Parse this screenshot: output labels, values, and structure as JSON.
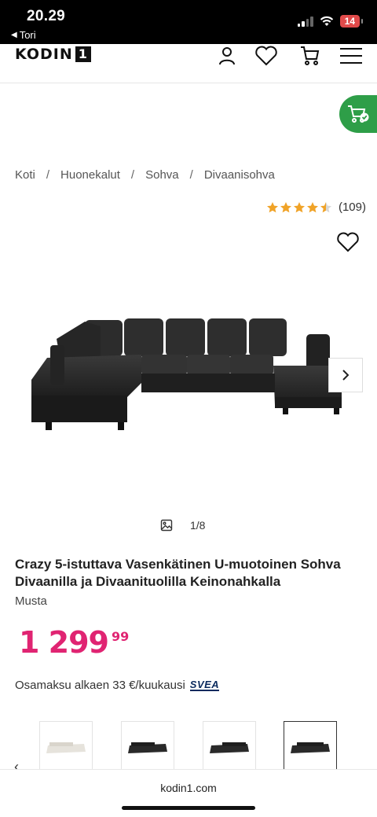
{
  "status_bar": {
    "time": "20.29",
    "back_app": "Tori",
    "battery": "14"
  },
  "header": {
    "logo_text": "KODIN",
    "logo_number": "1",
    "icons": [
      "user-icon",
      "heart-icon",
      "cart-icon",
      "menu-icon"
    ]
  },
  "floating_cart": {
    "icon": "cart-check-icon",
    "color": "#2e9e48"
  },
  "breadcrumb": [
    "Koti",
    "Huonekalut",
    "Sohva",
    "Divaanisohva"
  ],
  "breadcrumb_separator": "/",
  "rating": {
    "stars": 4.5,
    "out_of": 5,
    "count": "(109)",
    "star_color": "#f0a328"
  },
  "gallery": {
    "current": "1",
    "total": "8",
    "counter_text": "1/8"
  },
  "product": {
    "title": "Crazy 5-istuttava Vasenkätinen U-muotoinen Sohva Divaanilla ja Divaanituolilla Keinonahkalla",
    "variant": "Musta",
    "price_main": "1 299",
    "price_cents": "99",
    "price_color": "#e02472",
    "installment": "Osamaksu alkaen 33 €/kuukausi",
    "installment_provider": "SVEA"
  },
  "thumbnails": [
    {
      "color": "light-grey",
      "selected": false
    },
    {
      "color": "black",
      "selected": false
    },
    {
      "color": "black",
      "selected": false
    },
    {
      "color": "black",
      "selected": true
    }
  ],
  "browser": {
    "url": "kodin1.com"
  }
}
